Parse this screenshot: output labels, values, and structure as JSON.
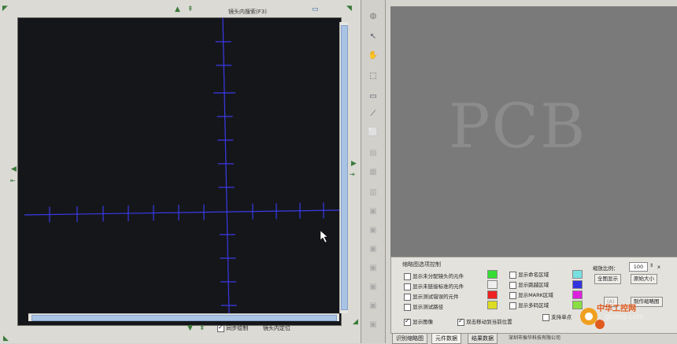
{
  "left_panel": {
    "title": "镜头内搜索(F3)",
    "sync_draw_label": "同步绘制",
    "sync_draw_checked": true,
    "lens_position_label": "镜头内定位"
  },
  "control_panel": {
    "title": "缩略图选项控制",
    "options_left": [
      {
        "label": "显示未分配镜头的元件",
        "checked": false
      },
      {
        "label": "显示未链接标准的元件",
        "checked": false
      },
      {
        "label": "显示测试错误的元件",
        "checked": false
      },
      {
        "label": "显示测试路径",
        "checked": false
      },
      {
        "label": "显示图像",
        "checked": true
      }
    ],
    "swatches_left": [
      "#33dd33",
      "#eeeeee",
      "#ee2222",
      "#dddd22"
    ],
    "options_mid": [
      {
        "label": "显示命名区域",
        "checked": false
      },
      {
        "label": "显示跳越区域",
        "checked": false
      },
      {
        "label": "显示MARK区域",
        "checked": false
      },
      {
        "label": "显示多码区域",
        "checked": false
      }
    ],
    "swatches_mid": [
      "#77e0e0",
      "#3333dd",
      "#dd22dd",
      "#88dd44"
    ],
    "click_move_label": "双击移动到当前位置",
    "click_move_checked": true,
    "support_single_label": "支持单点",
    "support_single_checked": false,
    "ratio_label": "缩放比例：",
    "ratio_value": "100",
    "ratio_unit": "x",
    "btn_full_view": "全图显示",
    "btn_original_size": "原始大小",
    "btn_make_thumbnail": "制作缩略图",
    "btn_partial": "(A)"
  },
  "pcb_view": {
    "text": "PCB"
  },
  "tabs": [
    {
      "label": "识别缩略图",
      "active": false
    },
    {
      "label": "元件数据",
      "active": true
    },
    {
      "label": "结果数据",
      "active": false
    }
  ],
  "company": "深圳市振华科技有限公司",
  "watermark": {
    "title": "中华工控网",
    "url": "gkong.com"
  },
  "colors": {
    "crosshair": "#3a3ae8",
    "canvas_bg": "#15161a",
    "pcb_bg": "#7a7a7a"
  }
}
